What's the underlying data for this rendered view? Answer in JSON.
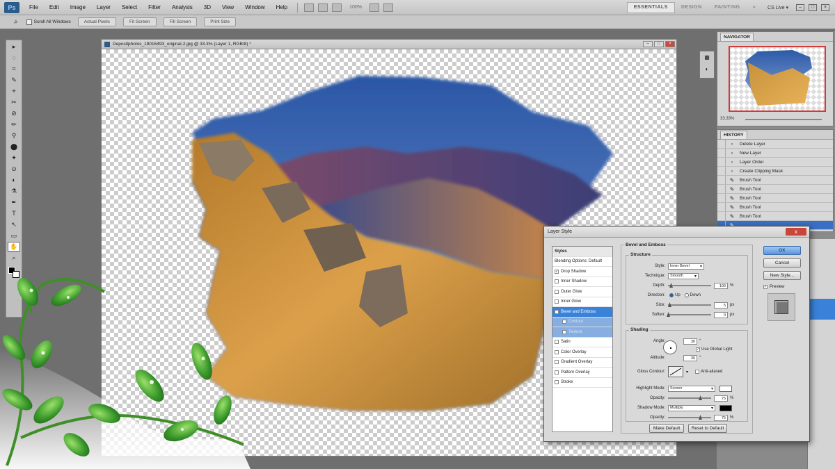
{
  "app": {
    "logo": "Ps"
  },
  "menu": [
    "File",
    "Edit",
    "Image",
    "Layer",
    "Select",
    "Filter",
    "Analysis",
    "3D",
    "View",
    "Window",
    "Help"
  ],
  "zoom_display": "100%",
  "workspace": {
    "buttons": [
      "ESSENTIALS",
      "DESIGN",
      "PAINTING"
    ],
    "more": "»",
    "cs_live": "CS Live ▾"
  },
  "window_controls": [
    "–",
    "□",
    "×"
  ],
  "options_bar": {
    "scroll_all_label": "Scroll All Windows",
    "buttons": [
      "Actual Pixels",
      "Fit Screen",
      "Fill Screen",
      "Print Size"
    ]
  },
  "tools": [
    "▸",
    "◌",
    "⌗",
    "✎",
    "⌖",
    "✂",
    "⊘",
    "✏",
    "⚲",
    "⬤",
    "✦",
    "⊙",
    "◐",
    "⚗",
    "✒",
    "T",
    "↖",
    "▭",
    "✋",
    "⌕"
  ],
  "document": {
    "title": "Depositphotos_18016493_original-2.jpg @ 33.3% (Layer 1, RGB/8) *"
  },
  "navigator": {
    "tab": "NAVIGATOR",
    "zoom": "33.33%"
  },
  "history": {
    "tab": "HISTORY",
    "items": [
      "Delete Layer",
      "New Layer",
      "Layer Order",
      "Create Clipping Mask",
      "Brush Tool",
      "Brush Tool",
      "Brush Tool",
      "Brush Tool",
      "Brush Tool",
      ""
    ]
  },
  "dialog": {
    "title": "Layer Style",
    "close": "x",
    "styles_header": "Styles",
    "blending": "Blending Options: Default",
    "style_items": [
      {
        "label": "Drop Shadow",
        "checked": true
      },
      {
        "label": "Inner Shadow",
        "checked": false
      },
      {
        "label": "Outer Glow",
        "checked": false
      },
      {
        "label": "Inner Glow",
        "checked": false
      },
      {
        "label": "Bevel and Emboss",
        "checked": true
      },
      {
        "label": "Contour",
        "checked": false
      },
      {
        "label": "Texture",
        "checked": false
      },
      {
        "label": "Satin",
        "checked": false
      },
      {
        "label": "Color Overlay",
        "checked": false
      },
      {
        "label": "Gradient Overlay",
        "checked": false
      },
      {
        "label": "Pattern Overlay",
        "checked": false
      },
      {
        "label": "Stroke",
        "checked": false
      }
    ],
    "bevel": {
      "title": "Bevel and Emboss",
      "structure": "Structure",
      "style_label": "Style:",
      "style_value": "Inner Bevel",
      "technique_label": "Technique:",
      "technique_value": "Smooth",
      "depth_label": "Depth:",
      "depth_value": "100",
      "depth_unit": "%",
      "direction_label": "Direction:",
      "dir_up": "Up",
      "dir_down": "Down",
      "size_label": "Size:",
      "size_value": "5",
      "size_unit": "px",
      "soften_label": "Soften:",
      "soften_value": "0",
      "soften_unit": "px",
      "shading": "Shading",
      "angle_label": "Angle:",
      "angle_value": "30",
      "angle_unit": "°",
      "global_light": "Use Global Light",
      "altitude_label": "Altitude:",
      "altitude_value": "30",
      "altitude_unit": "°",
      "gloss_label": "Gloss Contour:",
      "anti_aliased": "Anti-aliased",
      "highlight_label": "Highlight Mode:",
      "highlight_value": "Screen",
      "hl_opacity_label": "Opacity:",
      "hl_opacity_value": "75",
      "pct": "%",
      "shadow_label": "Shadow Mode:",
      "shadow_value": "Multiply",
      "sh_opacity_label": "Opacity:",
      "sh_opacity_value": "75"
    },
    "buttons": {
      "ok": "OK",
      "cancel": "Cancel",
      "new_style": "New Style...",
      "preview": "Preview",
      "make_default": "Make Default",
      "reset_default": "Reset to Default"
    },
    "colors": {
      "highlight": "#ffffff",
      "shadow": "#000000"
    }
  }
}
